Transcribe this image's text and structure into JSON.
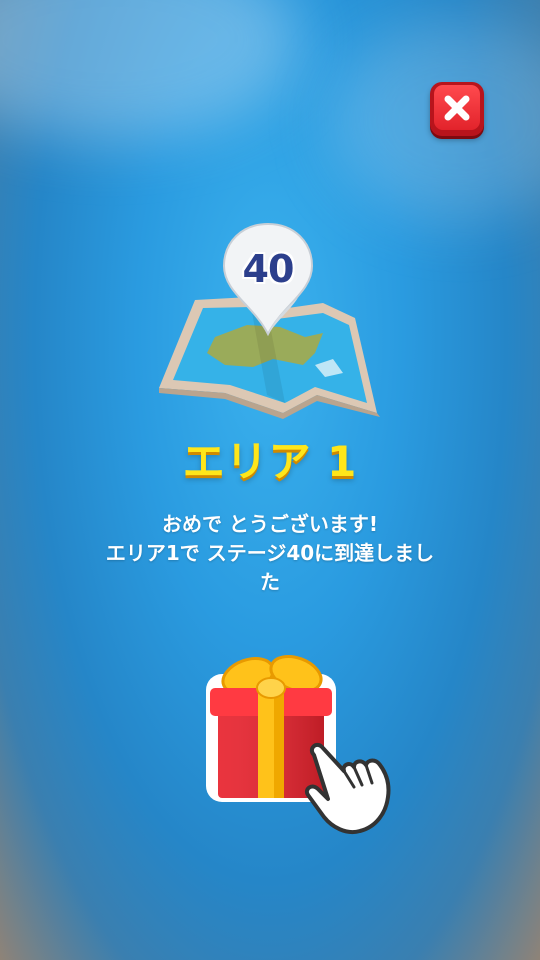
{
  "popup": {
    "stage_number": "40",
    "area_title": "エリア 1",
    "message_line1": "おめで とうございます!",
    "message_line2": "エリア1で ステージ40に到達しまし",
    "message_line3": "た"
  },
  "icons": {
    "close": "close-icon",
    "map": "map-icon",
    "pin": "location-pin-icon",
    "gift": "gift-box-icon",
    "hand": "pointing-hand-icon"
  },
  "colors": {
    "title_yellow": "#ffe61a",
    "close_red": "#e2232b",
    "pin_text": "#2c3f8c",
    "gift_red": "#e8232e",
    "ribbon_yellow": "#ffc21a"
  }
}
